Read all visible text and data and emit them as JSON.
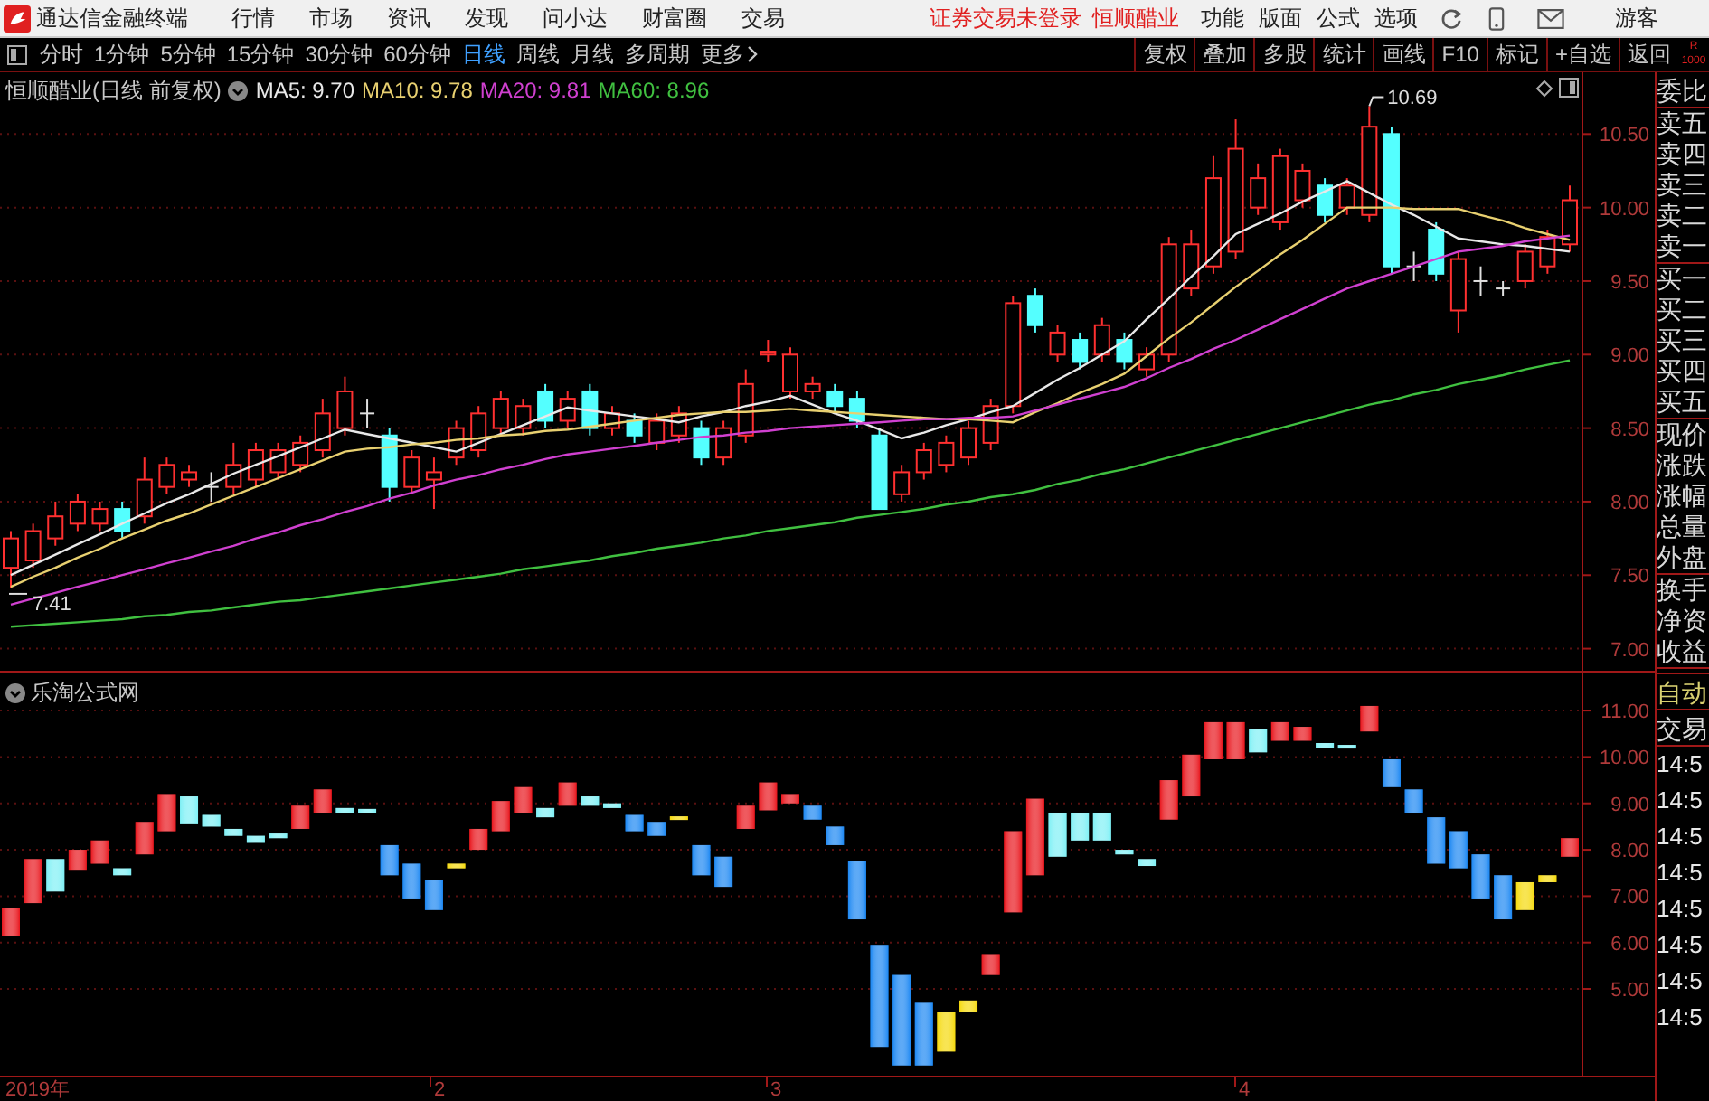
{
  "app": {
    "title": "通达信金融终端",
    "menu": [
      "行情",
      "市场",
      "资讯",
      "发现",
      "问小达",
      "财富圈",
      "交易"
    ],
    "notice": "证券交易未登录",
    "stock_link": "恒顺醋业",
    "tools": [
      "功能",
      "版面",
      "公式",
      "选项"
    ],
    "user": "游客"
  },
  "period_bar": {
    "tabs": [
      {
        "label": "分时",
        "selected": false
      },
      {
        "label": "1分钟",
        "selected": false
      },
      {
        "label": "5分钟",
        "selected": false
      },
      {
        "label": "15分钟",
        "selected": false
      },
      {
        "label": "30分钟",
        "selected": false
      },
      {
        "label": "60分钟",
        "selected": false
      },
      {
        "label": "日线",
        "selected": true
      },
      {
        "label": "周线",
        "selected": false
      },
      {
        "label": "月线",
        "selected": false
      },
      {
        "label": "多周期",
        "selected": false
      }
    ],
    "more": "更多",
    "buttons": [
      "复权",
      "叠加",
      "多股",
      "统计",
      "画线",
      "F10",
      "标记",
      "+自选",
      "返回"
    ],
    "corner": [
      "R",
      "1000"
    ]
  },
  "main_chart": {
    "title": "恒顺醋业(日线 前复权)",
    "indicators": [
      {
        "value": ": 9.70"
      },
      {
        "value": ": 9.78"
      },
      {
        "value": ": 9.81"
      },
      {
        "value": ": 8.96"
      }
    ],
    "high_label": "10.69",
    "low_label": "7.41",
    "chart_data": {
      "type": "candlestick",
      "grid": true,
      "ylim": [
        6.85,
        10.92
      ],
      "categories": [
        null,
        null,
        null,
        null,
        null,
        null,
        null,
        null,
        null,
        null,
        null,
        null,
        null,
        null,
        null,
        null,
        null,
        null,
        null,
        null,
        null,
        null,
        null,
        null,
        null,
        null,
        null,
        null,
        null,
        null,
        null,
        null,
        null,
        null,
        null,
        null,
        null,
        null,
        null,
        null,
        null,
        null,
        null,
        null,
        null,
        null,
        null,
        null,
        null,
        null,
        null,
        null,
        null,
        null,
        null,
        null,
        null,
        null,
        null,
        null,
        null,
        null,
        null,
        null,
        null,
        null,
        null,
        null,
        null,
        null,
        null
      ],
      "yticks": [
        {
          "value": 10.5,
          "label": "10.50"
        },
        {
          "value": 10,
          "label": "10.00"
        },
        {
          "value": 9.5,
          "label": "9.50"
        },
        {
          "value": 9,
          "label": "9.00"
        },
        {
          "value": 8.5,
          "label": "8.50"
        },
        {
          "value": 8,
          "label": "8.00"
        },
        {
          "value": 7.5,
          "label": "7.50"
        },
        {
          "value": 7,
          "label": "7.00"
        }
      ],
      "series": [
        {
          "name": "MA5",
          "type": "line",
          "color": "#e8e8e8",
          "values": [
            7.5,
            7.57,
            7.64,
            7.71,
            7.78,
            7.85,
            7.92,
            7.99,
            8.05,
            8.12,
            8.19,
            8.25,
            8.31,
            8.37,
            8.43,
            8.49,
            8.46,
            8.43,
            8.4,
            8.37,
            8.34,
            8.4,
            8.46,
            8.52,
            8.58,
            8.64,
            8.62,
            8.6,
            8.58,
            8.56,
            8.54,
            8.58,
            8.61,
            8.65,
            8.68,
            8.72,
            8.66,
            8.6,
            8.55,
            8.49,
            8.43,
            8.47,
            8.52,
            8.56,
            8.61,
            8.65,
            8.74,
            8.83,
            8.91,
            9.0,
            9.09,
            9.24,
            9.38,
            9.53,
            9.67,
            9.82,
            9.89,
            9.96,
            10.04,
            10.11,
            10.18,
            10.1,
            10.02,
            9.95,
            9.87,
            9.79,
            9.77,
            9.75,
            9.74,
            9.72,
            9.7
          ]
        },
        {
          "name": "MA10",
          "type": "line",
          "color": "#e8d070",
          "values": [
            7.42,
            7.49,
            7.55,
            7.62,
            7.68,
            7.75,
            7.81,
            7.87,
            7.92,
            7.98,
            8.04,
            8.1,
            8.16,
            8.22,
            8.28,
            8.34,
            8.36,
            8.37,
            8.39,
            8.4,
            8.42,
            8.43,
            8.45,
            8.46,
            8.48,
            8.49,
            8.51,
            8.53,
            8.55,
            8.57,
            8.59,
            8.6,
            8.61,
            8.61,
            8.62,
            8.63,
            8.62,
            8.61,
            8.6,
            8.59,
            8.58,
            8.57,
            8.56,
            8.56,
            8.55,
            8.54,
            8.61,
            8.67,
            8.74,
            8.8,
            8.87,
            8.99,
            9.11,
            9.22,
            9.34,
            9.46,
            9.57,
            9.68,
            9.78,
            9.89,
            10.0,
            10.0,
            10.0,
            9.99,
            9.99,
            9.99,
            9.95,
            9.91,
            9.86,
            9.82,
            9.78
          ]
        },
        {
          "name": "MA20",
          "type": "line",
          "color": "#d040d0",
          "values": [
            7.3,
            7.34,
            7.38,
            7.42,
            7.46,
            7.5,
            7.54,
            7.58,
            7.62,
            7.66,
            7.7,
            7.75,
            7.79,
            7.84,
            7.88,
            7.93,
            7.97,
            8.02,
            8.06,
            8.11,
            8.15,
            8.18,
            8.22,
            8.25,
            8.29,
            8.32,
            8.34,
            8.36,
            8.38,
            8.4,
            8.42,
            8.44,
            8.45,
            8.47,
            8.48,
            8.5,
            8.51,
            8.52,
            8.53,
            8.54,
            8.55,
            8.56,
            8.56,
            8.57,
            8.57,
            8.58,
            8.62,
            8.66,
            8.7,
            8.74,
            8.78,
            8.84,
            8.91,
            8.97,
            9.04,
            9.1,
            9.17,
            9.24,
            9.31,
            9.38,
            9.45,
            9.5,
            9.55,
            9.6,
            9.65,
            9.7,
            9.72,
            9.74,
            9.77,
            9.79,
            9.81
          ]
        },
        {
          "name": "MA60",
          "type": "line",
          "color": "#40c040",
          "values": [
            7.15,
            7.16,
            7.17,
            7.18,
            7.19,
            7.2,
            7.22,
            7.23,
            7.25,
            7.26,
            7.28,
            7.3,
            7.32,
            7.33,
            7.35,
            7.37,
            7.39,
            7.41,
            7.43,
            7.45,
            7.47,
            7.49,
            7.51,
            7.54,
            7.56,
            7.58,
            7.6,
            7.63,
            7.65,
            7.68,
            7.7,
            7.72,
            7.75,
            7.77,
            7.8,
            7.82,
            7.84,
            7.86,
            7.89,
            7.91,
            7.93,
            7.95,
            7.98,
            8.0,
            8.03,
            8.05,
            8.08,
            8.12,
            8.15,
            8.19,
            8.22,
            8.26,
            8.3,
            8.34,
            8.38,
            8.42,
            8.46,
            8.5,
            8.54,
            8.58,
            8.62,
            8.66,
            8.69,
            8.73,
            8.76,
            8.8,
            8.83,
            8.86,
            8.9,
            8.93,
            8.96
          ]
        }
      ],
      "ohlc": [
        [
          7.55,
          7.8,
          7.41,
          7.75
        ],
        [
          7.6,
          7.85,
          7.55,
          7.8
        ],
        [
          7.75,
          8.0,
          7.7,
          7.9
        ],
        [
          7.85,
          8.05,
          7.8,
          8.0
        ],
        [
          7.85,
          8.0,
          7.8,
          7.95
        ],
        [
          7.95,
          8.0,
          7.75,
          7.8
        ],
        [
          7.9,
          8.3,
          7.85,
          8.15
        ],
        [
          8.1,
          8.3,
          8.05,
          8.25
        ],
        [
          8.15,
          8.25,
          8.1,
          8.2
        ],
        [
          8.1,
          8.2,
          8.0,
          8.1
        ],
        [
          8.1,
          8.4,
          8.05,
          8.25
        ],
        [
          8.15,
          8.4,
          8.1,
          8.35
        ],
        [
          8.2,
          8.4,
          8.15,
          8.35
        ],
        [
          8.25,
          8.45,
          8.2,
          8.4
        ],
        [
          8.35,
          8.7,
          8.3,
          8.6
        ],
        [
          8.5,
          8.85,
          8.45,
          8.75
        ],
        [
          8.6,
          8.7,
          8.5,
          8.6
        ],
        [
          8.45,
          8.5,
          8.0,
          8.1
        ],
        [
          8.1,
          8.35,
          8.05,
          8.3
        ],
        [
          8.15,
          8.3,
          7.95,
          8.2
        ],
        [
          8.3,
          8.55,
          8.25,
          8.5
        ],
        [
          8.35,
          8.65,
          8.3,
          8.6
        ],
        [
          8.5,
          8.75,
          8.45,
          8.7
        ],
        [
          8.5,
          8.7,
          8.45,
          8.65
        ],
        [
          8.75,
          8.8,
          8.5,
          8.55
        ],
        [
          8.55,
          8.75,
          8.5,
          8.7
        ],
        [
          8.75,
          8.8,
          8.45,
          8.5
        ],
        [
          8.5,
          8.65,
          8.45,
          8.6
        ],
        [
          8.55,
          8.6,
          8.4,
          8.45
        ],
        [
          8.4,
          8.6,
          8.35,
          8.55
        ],
        [
          8.45,
          8.65,
          8.4,
          8.6
        ],
        [
          8.5,
          8.55,
          8.25,
          8.3
        ],
        [
          8.3,
          8.55,
          8.25,
          8.5
        ],
        [
          8.45,
          8.9,
          8.4,
          8.8
        ],
        [
          9.0,
          9.1,
          8.95,
          9.02
        ],
        [
          8.75,
          9.05,
          8.7,
          9.0
        ],
        [
          8.75,
          8.85,
          8.7,
          8.8
        ],
        [
          8.75,
          8.8,
          8.6,
          8.65
        ],
        [
          8.7,
          8.75,
          8.5,
          8.55
        ],
        [
          8.45,
          8.5,
          7.95,
          7.95
        ],
        [
          8.05,
          8.25,
          8.0,
          8.2
        ],
        [
          8.2,
          8.4,
          8.15,
          8.35
        ],
        [
          8.25,
          8.45,
          8.2,
          8.4
        ],
        [
          8.3,
          8.55,
          8.25,
          8.5
        ],
        [
          8.4,
          8.7,
          8.35,
          8.65
        ],
        [
          8.65,
          9.4,
          8.6,
          9.35
        ],
        [
          9.4,
          9.45,
          9.15,
          9.2
        ],
        [
          9.0,
          9.2,
          8.95,
          9.15
        ],
        [
          9.1,
          9.15,
          8.9,
          8.95
        ],
        [
          9.0,
          9.25,
          8.95,
          9.2
        ],
        [
          9.1,
          9.15,
          8.9,
          8.95
        ],
        [
          8.9,
          9.05,
          8.85,
          9.0
        ],
        [
          9.0,
          9.8,
          8.95,
          9.75
        ],
        [
          9.45,
          9.85,
          9.4,
          9.75
        ],
        [
          9.6,
          10.35,
          9.55,
          10.2
        ],
        [
          9.7,
          10.6,
          9.65,
          10.4
        ],
        [
          10.0,
          10.3,
          9.95,
          10.2
        ],
        [
          9.9,
          10.4,
          9.85,
          10.35
        ],
        [
          10.05,
          10.3,
          10.0,
          10.25
        ],
        [
          10.15,
          10.2,
          9.9,
          9.95
        ],
        [
          10.0,
          10.2,
          9.95,
          10.15
        ],
        [
          9.95,
          10.69,
          9.9,
          10.55
        ],
        [
          10.5,
          10.55,
          9.55,
          9.6
        ],
        [
          9.6,
          9.7,
          9.5,
          9.6
        ],
        [
          9.85,
          9.9,
          9.5,
          9.55
        ],
        [
          9.3,
          9.7,
          9.15,
          9.65
        ],
        [
          9.5,
          9.6,
          9.4,
          9.5
        ],
        [
          9.45,
          9.5,
          9.4,
          9.45
        ],
        [
          9.5,
          9.75,
          9.45,
          9.7
        ],
        [
          9.6,
          9.85,
          9.55,
          9.8
        ],
        [
          9.75,
          10.15,
          9.7,
          10.05
        ]
      ]
    }
  },
  "sub_chart": {
    "title": "乐淘公式网",
    "chart_data": {
      "type": "candlestick",
      "grid": true,
      "ylim": [
        3.13,
        11.82
      ],
      "categories": [
        null,
        null,
        null,
        null,
        null,
        null,
        null,
        null,
        null,
        null,
        null,
        null,
        null,
        null,
        null,
        null,
        null,
        null,
        null,
        null,
        null,
        null,
        null,
        null,
        null,
        null,
        null,
        null,
        null,
        null,
        null,
        null,
        null,
        null,
        null,
        null,
        null,
        null,
        null,
        null,
        null,
        null,
        null,
        null,
        null,
        null,
        null,
        null,
        null,
        null,
        null,
        null,
        null,
        null,
        null,
        null,
        null,
        null,
        null,
        null,
        null,
        null,
        null,
        null,
        null,
        null,
        null,
        null,
        null,
        null,
        null
      ],
      "yticks": [
        {
          "value": 11,
          "label": "11.00"
        },
        {
          "value": 10,
          "label": "10.00"
        },
        {
          "value": 9,
          "label": "9.00"
        },
        {
          "value": 8,
          "label": "8.00"
        },
        {
          "value": 7,
          "label": "7.00"
        },
        {
          "value": 6,
          "label": "6.00"
        },
        {
          "value": 5,
          "label": "5.00"
        }
      ],
      "series": [
        {
          "color": "#e8141b",
          "ohlc": [
            [
              6.15,
              6.75,
              6.15,
              6.75
            ],
            [
              6.85,
              7.8,
              6.85,
              7.8
            ],
            null,
            [
              7.55,
              8.0,
              7.55,
              8.0
            ],
            [
              7.7,
              8.2,
              7.7,
              8.2
            ],
            null,
            [
              7.9,
              8.6,
              7.9,
              8.6
            ],
            [
              8.4,
              9.2,
              8.4,
              9.2
            ],
            null,
            null,
            null,
            null,
            null,
            [
              8.45,
              8.95,
              8.45,
              8.95
            ],
            [
              8.8,
              9.3,
              8.8,
              9.3
            ],
            null,
            null,
            null,
            null,
            null,
            null,
            [
              8.0,
              8.45,
              8.0,
              8.45
            ],
            [
              8.4,
              9.05,
              8.4,
              9.05
            ],
            [
              8.8,
              9.35,
              8.8,
              9.35
            ],
            null,
            [
              8.95,
              9.45,
              8.95,
              9.45
            ],
            null,
            null,
            null,
            null,
            null,
            null,
            null,
            [
              8.45,
              8.95,
              8.45,
              8.95
            ],
            [
              8.85,
              9.45,
              8.85,
              9.45
            ],
            [
              9.0,
              9.2,
              9.0,
              9.2
            ],
            null,
            null,
            null,
            null,
            null,
            null,
            null,
            null,
            [
              5.3,
              5.75,
              5.3,
              5.75
            ],
            [
              6.65,
              8.4,
              6.65,
              8.4
            ],
            [
              7.45,
              9.1,
              7.45,
              9.1
            ],
            null,
            null,
            null,
            null,
            null,
            [
              8.65,
              9.5,
              8.65,
              9.5
            ],
            [
              9.15,
              10.05,
              9.15,
              10.05
            ],
            [
              9.95,
              10.75,
              9.95,
              10.75
            ],
            [
              9.95,
              10.75,
              9.95,
              10.75
            ],
            null,
            [
              10.35,
              10.75,
              10.35,
              10.75
            ],
            [
              10.35,
              10.65,
              10.35,
              10.65
            ],
            null,
            null,
            [
              10.55,
              11.1,
              10.55,
              11.1
            ],
            null,
            null,
            null,
            null,
            null,
            null,
            null,
            null,
            [
              7.85,
              8.25,
              7.85,
              8.25
            ]
          ]
        },
        {
          "color": "#7ef0f5",
          "ohlc": [
            null,
            null,
            [
              7.1,
              7.8,
              7.1,
              7.8
            ],
            null,
            null,
            [
              7.45,
              7.6,
              7.45,
              7.6
            ],
            null,
            null,
            [
              8.55,
              9.15,
              8.55,
              9.15
            ],
            [
              8.5,
              8.75,
              8.5,
              8.75
            ],
            [
              8.3,
              8.45,
              8.3,
              8.45
            ],
            [
              8.15,
              8.3,
              8.15,
              8.3
            ],
            [
              8.25,
              8.35,
              8.25,
              8.35
            ],
            null,
            null,
            [
              8.8,
              8.9,
              8.8,
              8.9
            ],
            [
              8.8,
              8.88,
              8.8,
              8.88
            ],
            null,
            null,
            null,
            null,
            null,
            null,
            null,
            [
              8.7,
              8.9,
              8.7,
              8.9
            ],
            null,
            [
              8.95,
              9.15,
              8.95,
              9.15
            ],
            [
              8.9,
              9.0,
              8.9,
              9.0
            ],
            null,
            null,
            null,
            null,
            null,
            null,
            null,
            null,
            null,
            null,
            null,
            null,
            null,
            null,
            null,
            null,
            null,
            null,
            null,
            [
              7.85,
              8.8,
              7.85,
              8.8
            ],
            [
              8.2,
              8.8,
              8.2,
              8.8
            ],
            [
              8.2,
              8.8,
              8.2,
              8.8
            ],
            [
              7.9,
              8.0,
              7.9,
              8.0
            ],
            [
              7.65,
              7.8,
              7.65,
              7.8
            ],
            null,
            null,
            null,
            null,
            [
              10.1,
              10.6,
              10.1,
              10.6
            ],
            null,
            null,
            [
              10.2,
              10.3,
              10.2,
              10.3
            ],
            [
              10.2,
              10.26,
              10.2,
              10.26
            ],
            null,
            null,
            null,
            null,
            null,
            null,
            null,
            null,
            null,
            null
          ]
        },
        {
          "color": "#1a86f2",
          "ohlc": [
            null,
            null,
            null,
            null,
            null,
            null,
            null,
            null,
            null,
            null,
            null,
            null,
            null,
            null,
            null,
            null,
            null,
            [
              7.45,
              8.1,
              7.45,
              8.1
            ],
            [
              6.95,
              7.7,
              6.95,
              7.7
            ],
            [
              6.7,
              7.35,
              6.7,
              7.35
            ],
            null,
            null,
            null,
            null,
            null,
            null,
            null,
            null,
            [
              8.4,
              8.75,
              8.4,
              8.75
            ],
            [
              8.3,
              8.6,
              8.3,
              8.6
            ],
            null,
            [
              7.45,
              8.1,
              7.45,
              8.1
            ],
            [
              7.2,
              7.85,
              7.2,
              7.85
            ],
            null,
            null,
            null,
            [
              8.65,
              8.95,
              8.65,
              8.95
            ],
            [
              8.1,
              8.5,
              8.1,
              8.5
            ],
            [
              6.5,
              7.75,
              6.5,
              7.75
            ],
            [
              3.75,
              5.95,
              3.75,
              5.95
            ],
            [
              3.35,
              5.3,
              3.35,
              5.3
            ],
            [
              3.35,
              4.7,
              3.35,
              4.7
            ],
            null,
            null,
            null,
            null,
            null,
            null,
            null,
            null,
            null,
            null,
            null,
            null,
            null,
            null,
            null,
            null,
            null,
            null,
            null,
            null,
            [
              9.35,
              9.95,
              9.35,
              9.95
            ],
            [
              8.8,
              9.3,
              8.8,
              9.3
            ],
            [
              7.7,
              8.7,
              7.7,
              8.7
            ],
            [
              7.6,
              8.4,
              7.6,
              8.4
            ],
            [
              6.95,
              7.9,
              6.95,
              7.9
            ],
            [
              6.5,
              7.45,
              6.5,
              7.45
            ],
            null,
            null,
            null
          ]
        },
        {
          "color": "#f5d90a",
          "ohlc": [
            null,
            null,
            null,
            null,
            null,
            null,
            null,
            null,
            null,
            null,
            null,
            null,
            null,
            null,
            null,
            null,
            null,
            null,
            null,
            null,
            [
              7.6,
              7.7,
              7.6,
              7.7
            ],
            null,
            null,
            null,
            null,
            null,
            null,
            null,
            null,
            null,
            [
              8.65,
              8.72,
              8.65,
              8.72
            ],
            null,
            null,
            null,
            null,
            null,
            null,
            null,
            null,
            null,
            null,
            null,
            [
              3.65,
              4.5,
              3.65,
              4.5
            ],
            [
              4.5,
              4.75,
              4.5,
              4.75
            ],
            null,
            null,
            null,
            null,
            null,
            null,
            null,
            null,
            null,
            null,
            null,
            null,
            null,
            null,
            null,
            null,
            null,
            null,
            null,
            null,
            null,
            null,
            null,
            null,
            [
              6.7,
              7.3,
              6.7,
              7.3
            ],
            [
              7.3,
              7.45,
              7.3,
              7.45
            ],
            null
          ]
        }
      ]
    }
  },
  "time_axis": [
    "2019年",
    "2",
    "3",
    "4"
  ],
  "quote_panel": {
    "groups": [
      [
        "委比"
      ],
      [
        "卖五",
        "卖四",
        "卖三",
        "卖二",
        "卖一"
      ],
      [
        "买一",
        "买二",
        "买三",
        "买四",
        "买五"
      ],
      [
        "现价",
        "涨跌",
        "涨幅",
        "总量",
        "外盘"
      ],
      [
        "换手",
        "净资",
        "收益"
      ]
    ],
    "mode": "自动",
    "trade_label": "交易",
    "trades": [
      "14:5",
      "14:5",
      "14:5",
      "14:5",
      "14:5",
      "14:5",
      "14:5",
      "14:5"
    ]
  }
}
